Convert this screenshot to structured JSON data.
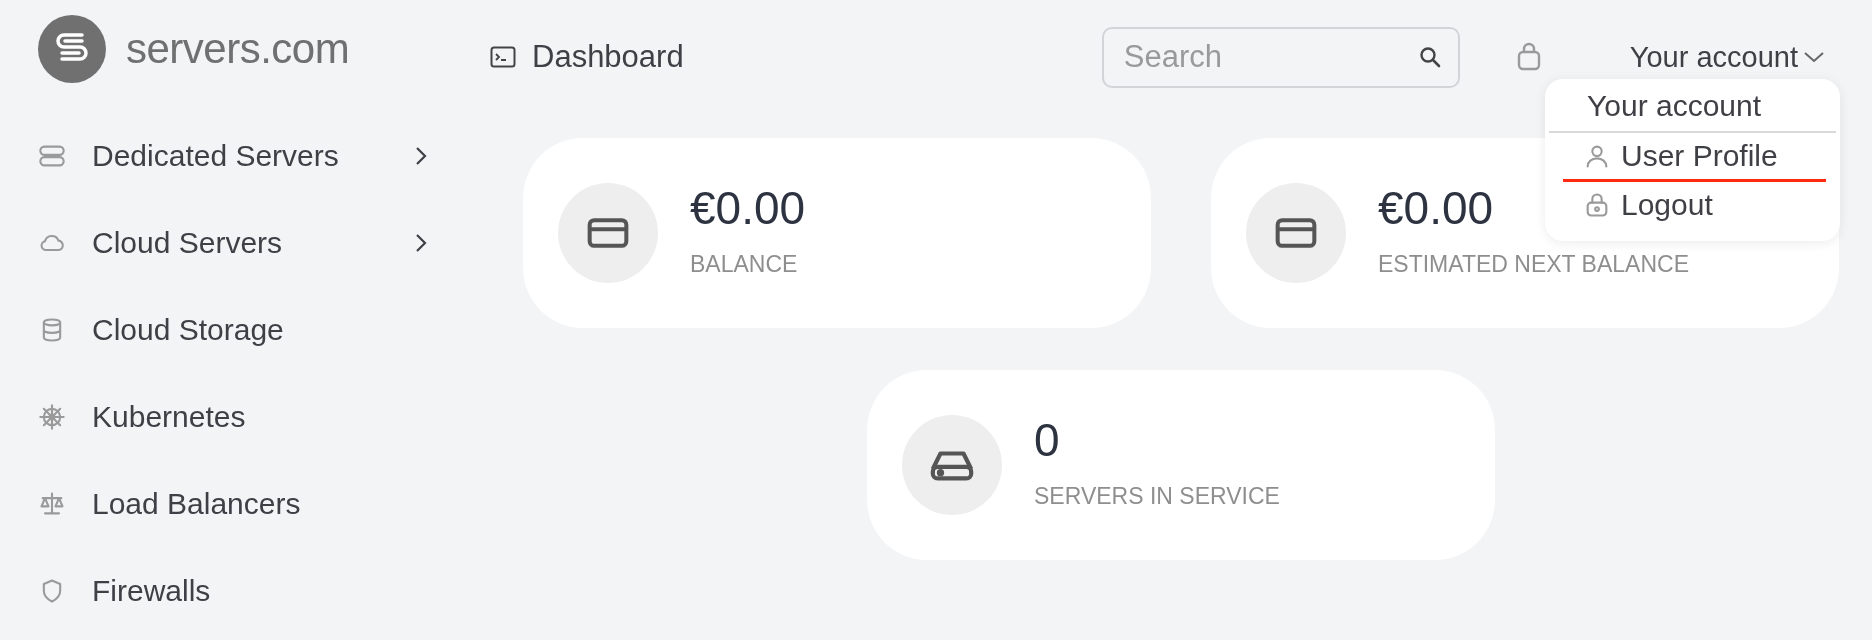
{
  "brand": {
    "name": "servers.com"
  },
  "sidebar": {
    "items": [
      {
        "label": "Dedicated Servers",
        "kind": "servers",
        "has_submenu": true
      },
      {
        "label": "Cloud Servers",
        "kind": "cloud",
        "has_submenu": true
      },
      {
        "label": "Cloud Storage",
        "kind": "database",
        "has_submenu": false
      },
      {
        "label": "Kubernetes",
        "kind": "helm",
        "has_submenu": false
      },
      {
        "label": "Load Balancers",
        "kind": "scale",
        "has_submenu": false
      },
      {
        "label": "Firewalls",
        "kind": "shield",
        "has_submenu": false
      }
    ]
  },
  "header": {
    "page_title": "Dashboard",
    "search": {
      "placeholder": "Search"
    },
    "account_menu": {
      "label": "Your account",
      "expanded": true,
      "dropdown": {
        "title": "Your account",
        "items": [
          {
            "label": "User Profile",
            "kind": "user",
            "underlined": true
          },
          {
            "label": "Logout",
            "kind": "lock",
            "underlined": false
          }
        ]
      }
    }
  },
  "cards": [
    {
      "value": "€0.00",
      "label": "BALANCE",
      "kind": "card"
    },
    {
      "value": "€0.00",
      "label": "ESTIMATED NEXT BALANCE",
      "kind": "card"
    },
    {
      "value": "0",
      "label": "SERVERS IN SERVICE",
      "kind": "drive"
    }
  ]
}
